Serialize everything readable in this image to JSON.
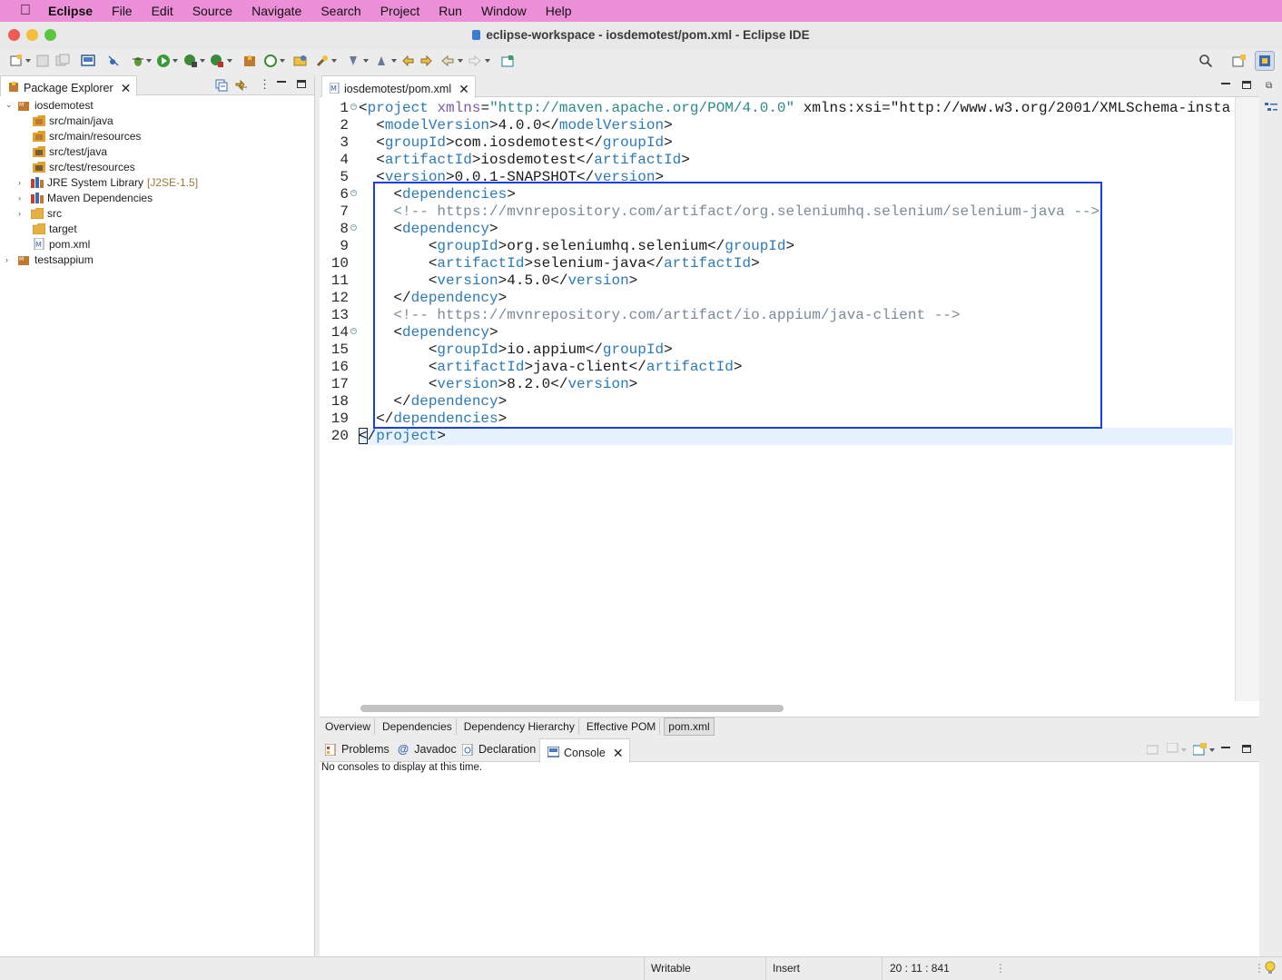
{
  "menubar": {
    "items": [
      "Eclipse",
      "File",
      "Edit",
      "Source",
      "Navigate",
      "Search",
      "Project",
      "Run",
      "Window",
      "Help"
    ]
  },
  "window": {
    "title": "eclipse-workspace - iosdemotest/pom.xml - Eclipse IDE"
  },
  "explorer": {
    "tab_label": "Package Explorer",
    "tree": [
      {
        "label": "iosdemotest",
        "decoration": "",
        "expanded": true
      },
      {
        "label": "src/main/java",
        "decoration": ""
      },
      {
        "label": "src/main/resources",
        "decoration": ""
      },
      {
        "label": "src/test/java",
        "decoration": ""
      },
      {
        "label": "src/test/resources",
        "decoration": ""
      },
      {
        "label": "JRE System Library",
        "decoration": "[J2SE-1.5]"
      },
      {
        "label": "Maven Dependencies",
        "decoration": ""
      },
      {
        "label": "src",
        "decoration": ""
      },
      {
        "label": "target",
        "decoration": ""
      },
      {
        "label": "pom.xml",
        "decoration": ""
      },
      {
        "label": "testsappium",
        "decoration": ""
      }
    ]
  },
  "editor": {
    "tab_label": "iosdemotest/pom.xml",
    "line_numbers": [
      "1",
      "2",
      "3",
      "4",
      "5",
      "6",
      "7",
      "8",
      "9",
      "10",
      "11",
      "12",
      "13",
      "14",
      "15",
      "16",
      "17",
      "18",
      "19",
      "20"
    ],
    "lines": [
      "<project xmlns=\"http://maven.apache.org/POM/4.0.0\" xmlns:xsi=\"http://www.w3.org/2001/XMLSchema-insta",
      "  <modelVersion>4.0.0</modelVersion>",
      "  <groupId>com.iosdemotest</groupId>",
      "  <artifactId>iosdemotest</artifactId>",
      "  <version>0.0.1-SNAPSHOT</version>",
      "    <dependencies>",
      "    <!-- https://mvnrepository.com/artifact/org.seleniumhq.selenium/selenium-java -->",
      "    <dependency>",
      "        <groupId>org.seleniumhq.selenium</groupId>",
      "        <artifactId>selenium-java</artifactId>",
      "        <version>4.5.0</version>",
      "    </dependency>",
      "    <!-- https://mvnrepository.com/artifact/io.appium/java-client -->",
      "    <dependency>",
      "        <groupId>io.appium</groupId>",
      "        <artifactId>java-client</artifactId>",
      "        <version>8.2.0</version>",
      "    </dependency>",
      "  </dependencies>",
      "</project>"
    ],
    "pom_tabs": [
      "Overview",
      "Dependencies",
      "Dependency Hierarchy",
      "Effective POM",
      "pom.xml"
    ],
    "active_pom_tab": "pom.xml"
  },
  "console": {
    "tabs": [
      "Problems",
      "Javadoc",
      "Declaration",
      "Console"
    ],
    "active_tab": "Console",
    "message": "No consoles to display at this time."
  },
  "statusbar": {
    "mode": "Writable",
    "insert": "Insert",
    "position": "20 : 11 : 841"
  },
  "colors": {
    "menubar_bg": "#ec8fd8",
    "tag": "#2a7ab8",
    "attribute": "#7a5aa8",
    "string": "#2a8a8a",
    "comment": "#7a8a9a",
    "selection_box": "#1a3fe0"
  }
}
